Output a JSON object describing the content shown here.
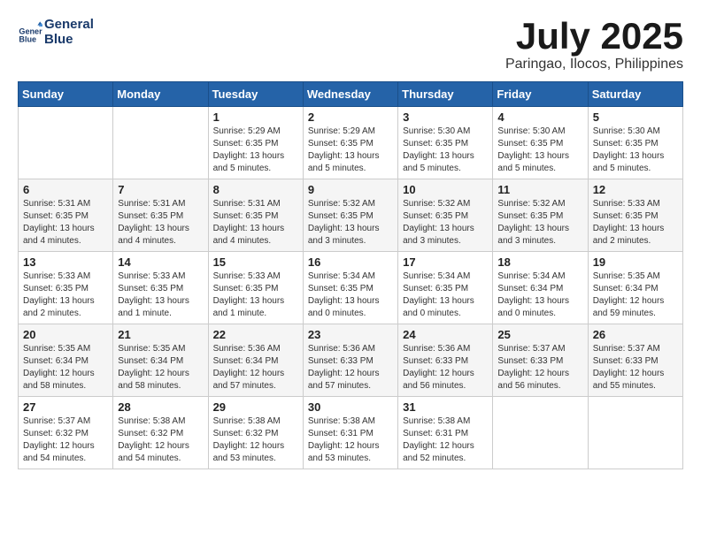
{
  "header": {
    "logo_line1": "General",
    "logo_line2": "Blue",
    "month": "July 2025",
    "location": "Paringao, Ilocos, Philippines"
  },
  "weekdays": [
    "Sunday",
    "Monday",
    "Tuesday",
    "Wednesday",
    "Thursday",
    "Friday",
    "Saturday"
  ],
  "weeks": [
    [
      {
        "day": "",
        "info": ""
      },
      {
        "day": "",
        "info": ""
      },
      {
        "day": "1",
        "info": "Sunrise: 5:29 AM\nSunset: 6:35 PM\nDaylight: 13 hours and 5 minutes."
      },
      {
        "day": "2",
        "info": "Sunrise: 5:29 AM\nSunset: 6:35 PM\nDaylight: 13 hours and 5 minutes."
      },
      {
        "day": "3",
        "info": "Sunrise: 5:30 AM\nSunset: 6:35 PM\nDaylight: 13 hours and 5 minutes."
      },
      {
        "day": "4",
        "info": "Sunrise: 5:30 AM\nSunset: 6:35 PM\nDaylight: 13 hours and 5 minutes."
      },
      {
        "day": "5",
        "info": "Sunrise: 5:30 AM\nSunset: 6:35 PM\nDaylight: 13 hours and 5 minutes."
      }
    ],
    [
      {
        "day": "6",
        "info": "Sunrise: 5:31 AM\nSunset: 6:35 PM\nDaylight: 13 hours and 4 minutes."
      },
      {
        "day": "7",
        "info": "Sunrise: 5:31 AM\nSunset: 6:35 PM\nDaylight: 13 hours and 4 minutes."
      },
      {
        "day": "8",
        "info": "Sunrise: 5:31 AM\nSunset: 6:35 PM\nDaylight: 13 hours and 4 minutes."
      },
      {
        "day": "9",
        "info": "Sunrise: 5:32 AM\nSunset: 6:35 PM\nDaylight: 13 hours and 3 minutes."
      },
      {
        "day": "10",
        "info": "Sunrise: 5:32 AM\nSunset: 6:35 PM\nDaylight: 13 hours and 3 minutes."
      },
      {
        "day": "11",
        "info": "Sunrise: 5:32 AM\nSunset: 6:35 PM\nDaylight: 13 hours and 3 minutes."
      },
      {
        "day": "12",
        "info": "Sunrise: 5:33 AM\nSunset: 6:35 PM\nDaylight: 13 hours and 2 minutes."
      }
    ],
    [
      {
        "day": "13",
        "info": "Sunrise: 5:33 AM\nSunset: 6:35 PM\nDaylight: 13 hours and 2 minutes."
      },
      {
        "day": "14",
        "info": "Sunrise: 5:33 AM\nSunset: 6:35 PM\nDaylight: 13 hours and 1 minute."
      },
      {
        "day": "15",
        "info": "Sunrise: 5:33 AM\nSunset: 6:35 PM\nDaylight: 13 hours and 1 minute."
      },
      {
        "day": "16",
        "info": "Sunrise: 5:34 AM\nSunset: 6:35 PM\nDaylight: 13 hours and 0 minutes."
      },
      {
        "day": "17",
        "info": "Sunrise: 5:34 AM\nSunset: 6:35 PM\nDaylight: 13 hours and 0 minutes."
      },
      {
        "day": "18",
        "info": "Sunrise: 5:34 AM\nSunset: 6:34 PM\nDaylight: 13 hours and 0 minutes."
      },
      {
        "day": "19",
        "info": "Sunrise: 5:35 AM\nSunset: 6:34 PM\nDaylight: 12 hours and 59 minutes."
      }
    ],
    [
      {
        "day": "20",
        "info": "Sunrise: 5:35 AM\nSunset: 6:34 PM\nDaylight: 12 hours and 58 minutes."
      },
      {
        "day": "21",
        "info": "Sunrise: 5:35 AM\nSunset: 6:34 PM\nDaylight: 12 hours and 58 minutes."
      },
      {
        "day": "22",
        "info": "Sunrise: 5:36 AM\nSunset: 6:34 PM\nDaylight: 12 hours and 57 minutes."
      },
      {
        "day": "23",
        "info": "Sunrise: 5:36 AM\nSunset: 6:33 PM\nDaylight: 12 hours and 57 minutes."
      },
      {
        "day": "24",
        "info": "Sunrise: 5:36 AM\nSunset: 6:33 PM\nDaylight: 12 hours and 56 minutes."
      },
      {
        "day": "25",
        "info": "Sunrise: 5:37 AM\nSunset: 6:33 PM\nDaylight: 12 hours and 56 minutes."
      },
      {
        "day": "26",
        "info": "Sunrise: 5:37 AM\nSunset: 6:33 PM\nDaylight: 12 hours and 55 minutes."
      }
    ],
    [
      {
        "day": "27",
        "info": "Sunrise: 5:37 AM\nSunset: 6:32 PM\nDaylight: 12 hours and 54 minutes."
      },
      {
        "day": "28",
        "info": "Sunrise: 5:38 AM\nSunset: 6:32 PM\nDaylight: 12 hours and 54 minutes."
      },
      {
        "day": "29",
        "info": "Sunrise: 5:38 AM\nSunset: 6:32 PM\nDaylight: 12 hours and 53 minutes."
      },
      {
        "day": "30",
        "info": "Sunrise: 5:38 AM\nSunset: 6:31 PM\nDaylight: 12 hours and 53 minutes."
      },
      {
        "day": "31",
        "info": "Sunrise: 5:38 AM\nSunset: 6:31 PM\nDaylight: 12 hours and 52 minutes."
      },
      {
        "day": "",
        "info": ""
      },
      {
        "day": "",
        "info": ""
      }
    ]
  ],
  "colors": {
    "header_bg": "#2563a8",
    "accent": "#1a3a6b"
  }
}
